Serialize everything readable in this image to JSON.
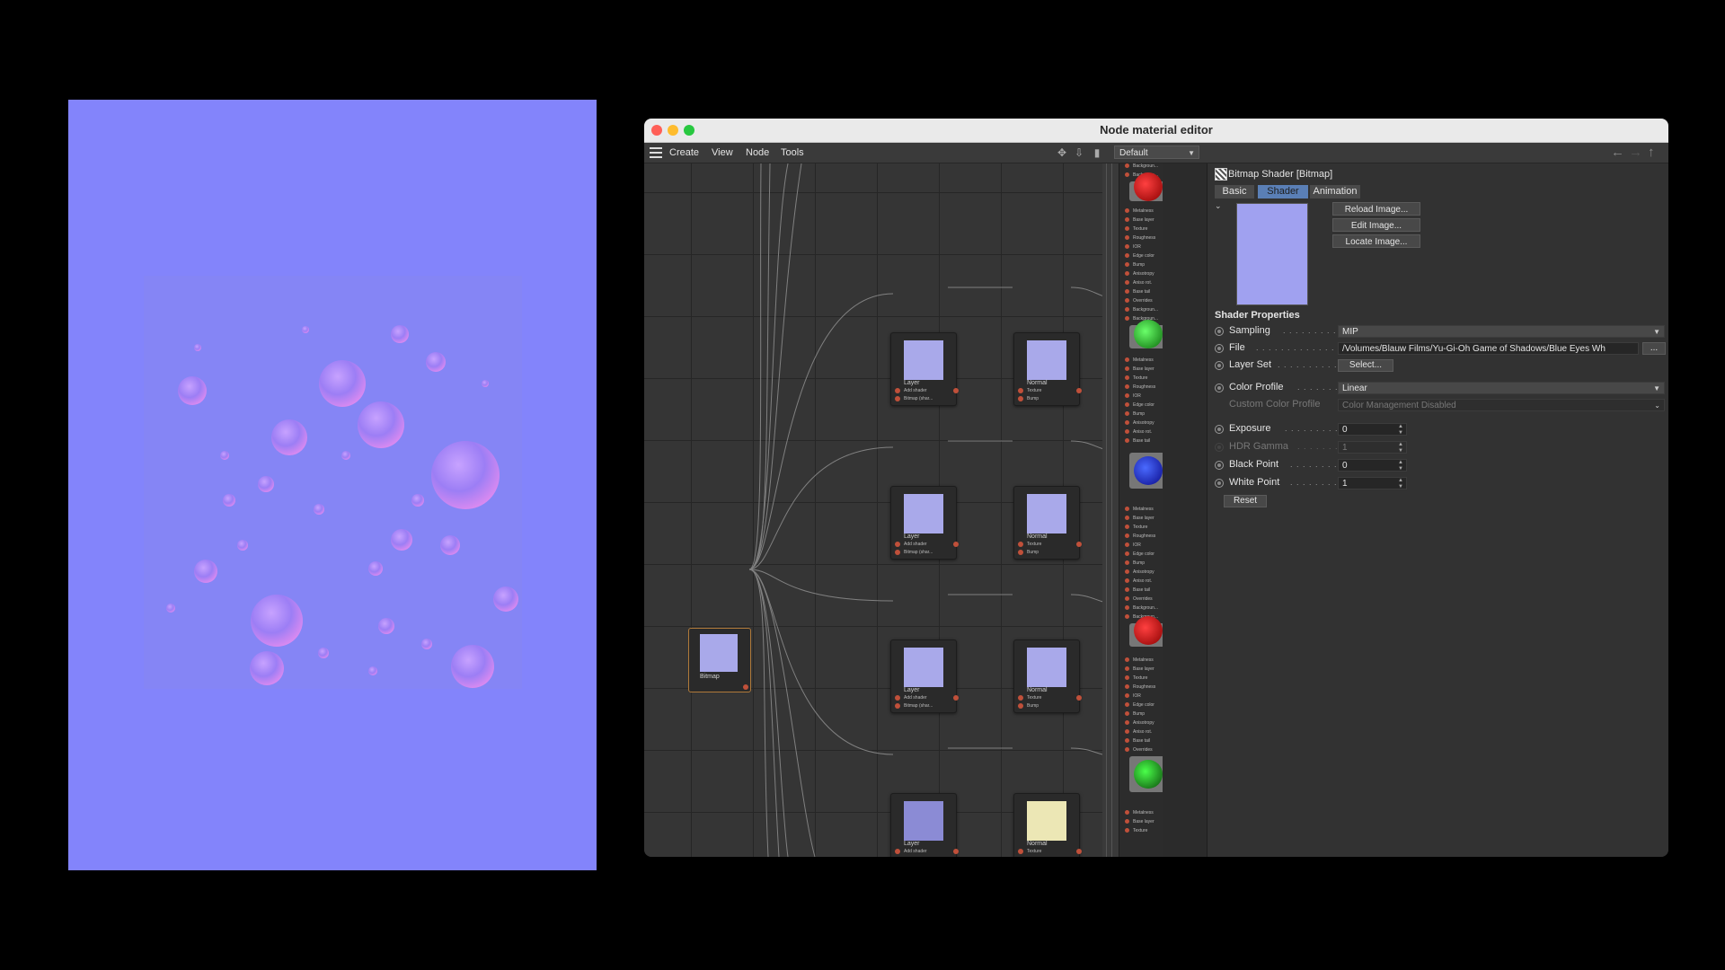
{
  "window": {
    "title": "Node material editor"
  },
  "menu": {
    "items": [
      "Create",
      "View",
      "Node",
      "Tools"
    ],
    "layout": "Default"
  },
  "graph": {
    "bitmap_node": {
      "label": "Bitmap"
    },
    "layer_node": {
      "label": "Layer",
      "ports": [
        "Add shader",
        "Bitmap (shar..."
      ]
    },
    "normal_node": {
      "label": "Normal",
      "ports": [
        "Texture",
        "Bump"
      ]
    }
  },
  "material_ports": [
    "Metalness",
    "Base layer",
    "Texture",
    "Roughness",
    "IOR",
    "Edge color",
    "Bump",
    "Anisotropy",
    "Aniso rot.",
    "Base tail",
    "Overrides",
    "Backgroun...",
    "Backgroun..."
  ],
  "attr": {
    "title": "Bitmap Shader [Bitmap]",
    "tabs": [
      "Basic",
      "Shader",
      "Animation"
    ],
    "active_tab": "Shader",
    "buttons": {
      "reload": "Reload Image...",
      "edit": "Edit Image...",
      "locate": "Locate Image..."
    },
    "section": "Shader Properties",
    "sampling": {
      "label": "Sampling",
      "value": "MIP"
    },
    "file": {
      "label": "File",
      "value": "/Volumes/Blauw Films/Yu-Gi-Oh Game of Shadows/Blue Eyes Wh",
      "browse": "..."
    },
    "layer_set": {
      "label": "Layer Set",
      "button": "Select..."
    },
    "color_profile": {
      "label": "Color Profile",
      "value": "Linear"
    },
    "custom_color_profile": {
      "label": "Custom Color Profile",
      "value": "Color Management Disabled"
    },
    "exposure": {
      "label": "Exposure",
      "value": "0"
    },
    "hdr_gamma": {
      "label": "HDR Gamma",
      "value": "1"
    },
    "black_point": {
      "label": "Black Point",
      "value": "0"
    },
    "white_point": {
      "label": "White Point",
      "value": "1"
    },
    "reset": "Reset"
  },
  "colors": {
    "normal_map": "#8384fb",
    "accent": "#5a7fb6",
    "selected_node": "#b07a3a"
  }
}
